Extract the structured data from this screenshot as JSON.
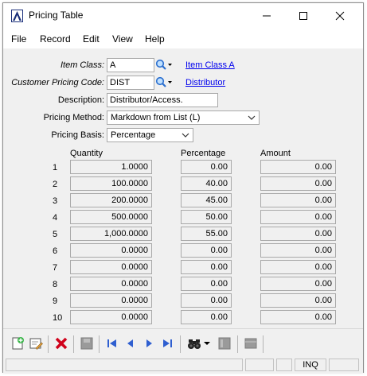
{
  "window": {
    "title": "Pricing Table"
  },
  "menu": [
    "File",
    "Record",
    "Edit",
    "View",
    "Help"
  ],
  "form": {
    "item_class": {
      "label": "Item Class:",
      "value": "A",
      "link": "Item Class A"
    },
    "customer_pricing_code": {
      "label": "Customer Pricing Code:",
      "value": "DIST",
      "link": "Distributor"
    },
    "description": {
      "label": "Description:",
      "value": "Distributor/Access."
    },
    "pricing_method": {
      "label": "Pricing Method:",
      "value": "Markdown from List (L)"
    },
    "pricing_basis": {
      "label": "Pricing Basis:",
      "value": "Percentage"
    }
  },
  "table": {
    "headers": {
      "quantity": "Quantity",
      "percentage": "Percentage",
      "amount": "Amount"
    },
    "rows": [
      {
        "n": "1",
        "quantity": "1.0000",
        "percentage": "0.00",
        "amount": "0.00"
      },
      {
        "n": "2",
        "quantity": "100.0000",
        "percentage": "40.00",
        "amount": "0.00"
      },
      {
        "n": "3",
        "quantity": "200.0000",
        "percentage": "45.00",
        "amount": "0.00"
      },
      {
        "n": "4",
        "quantity": "500.0000",
        "percentage": "50.00",
        "amount": "0.00"
      },
      {
        "n": "5",
        "quantity": "1,000.0000",
        "percentage": "55.00",
        "amount": "0.00"
      },
      {
        "n": "6",
        "quantity": "0.0000",
        "percentage": "0.00",
        "amount": "0.00"
      },
      {
        "n": "7",
        "quantity": "0.0000",
        "percentage": "0.00",
        "amount": "0.00"
      },
      {
        "n": "8",
        "quantity": "0.0000",
        "percentage": "0.00",
        "amount": "0.00"
      },
      {
        "n": "9",
        "quantity": "0.0000",
        "percentage": "0.00",
        "amount": "0.00"
      },
      {
        "n": "10",
        "quantity": "0.0000",
        "percentage": "0.00",
        "amount": "0.00"
      }
    ]
  },
  "status": {
    "mode": "INQ"
  },
  "colors": {
    "link": "#0000ee",
    "accent": "#1a2f7a",
    "delete": "#d0021b",
    "nav": "#2f5fd0"
  }
}
